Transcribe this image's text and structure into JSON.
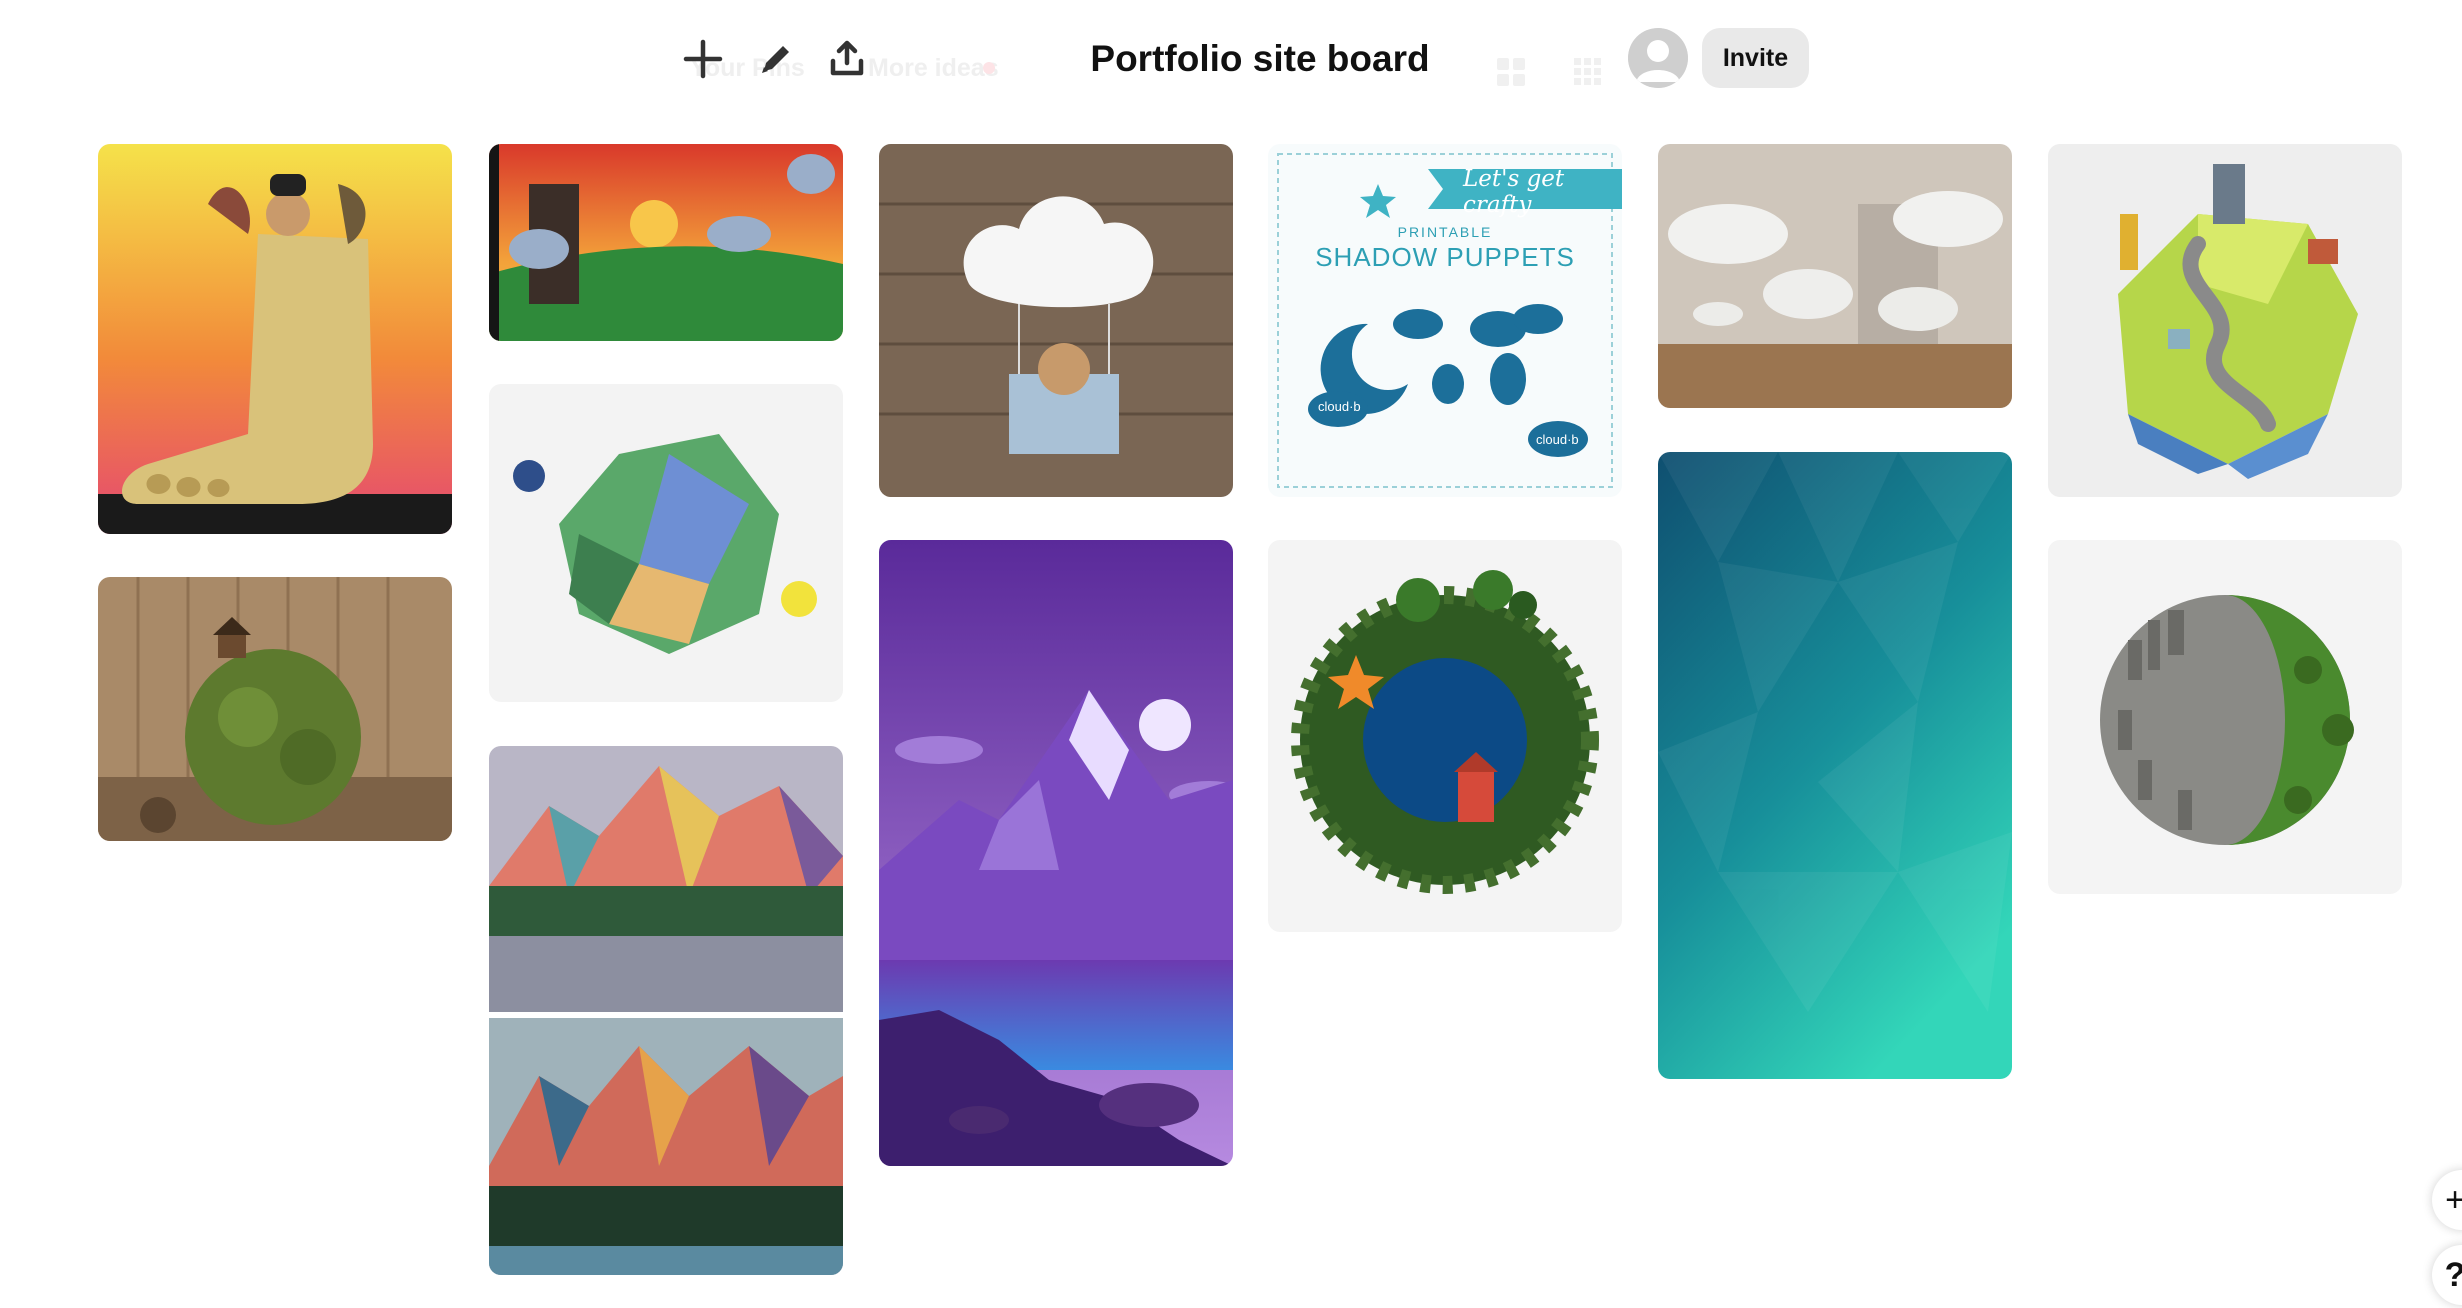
{
  "header": {
    "title": "Portfolio site board",
    "invite_label": "Invite",
    "faded_tabs": [
      "Your Pins",
      "More ideas"
    ]
  },
  "toolbar": {
    "icons": [
      "add-icon",
      "edit-icon",
      "share-icon"
    ],
    "view_icons": [
      "grid-default-icon",
      "grid-compact-icon"
    ]
  },
  "fab": {
    "icons": [
      "add-icon",
      "help-icon"
    ],
    "add_glyph": "+",
    "help_glyph": "?"
  },
  "pins": [
    {
      "name": "pin-foot-illustration",
      "kind": "image"
    },
    {
      "name": "pin-moss-ball-house",
      "kind": "image"
    },
    {
      "name": "pin-surreal-sunset-clouds",
      "kind": "image"
    },
    {
      "name": "pin-low-poly-planet",
      "kind": "image"
    },
    {
      "name": "pin-geometric-mountains",
      "kind": "image"
    },
    {
      "name": "pin-cloud-hot-air-balloon",
      "kind": "image"
    },
    {
      "name": "pin-purple-mountain-landscape",
      "kind": "image"
    },
    {
      "name": "pin-shadow-puppets",
      "kind": "image",
      "text": [
        "Let's get crafty",
        "PRINTABLE",
        "SHADOW PUPPETS",
        "cloud·b"
      ]
    },
    {
      "name": "pin-moss-wreath",
      "kind": "image"
    },
    {
      "name": "pin-cloud-room",
      "kind": "image"
    },
    {
      "name": "pin-teal-gradient",
      "kind": "image"
    },
    {
      "name": "pin-tiny-planet-town",
      "kind": "image"
    },
    {
      "name": "pin-tiny-planet-city",
      "kind": "image"
    }
  ],
  "colors": {
    "invite_bg": "#e9e9e9",
    "pin_placeholder": "#f3f3f3",
    "teal_top": "#0f4f70",
    "teal_bottom": "#33d6b9"
  }
}
